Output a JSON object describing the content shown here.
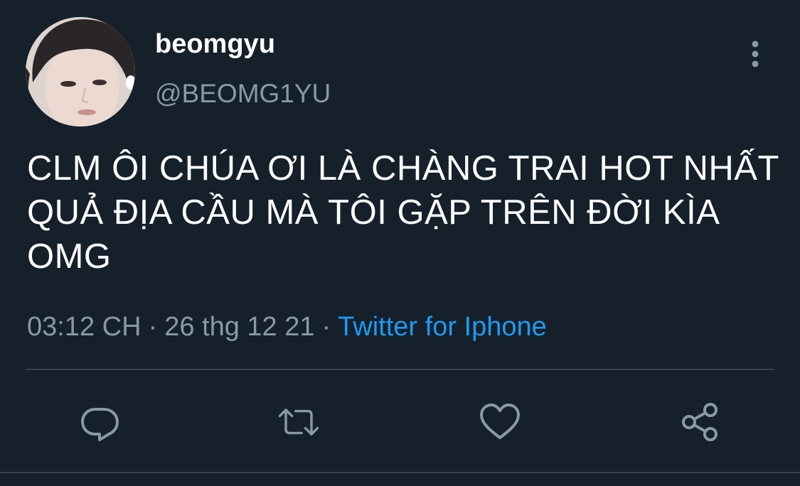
{
  "tweet": {
    "display_name": "beomgyu",
    "handle": "@BEOMG1YU",
    "text": "CLM ÔI CHÚA ƠI LÀ CHÀNG TRAI HOT NHẤT QUẢ ĐỊA CẦU MÀ TÔI GẶP TRÊN ĐỜI KÌA OMG",
    "time": "03:12 CH",
    "date": "26 thg 12 21",
    "source": "Twitter for Iphone",
    "sep1": "·",
    "sep2": "·"
  },
  "colors": {
    "background": "#15202b",
    "secondary_text": "#8899a6",
    "link": "#1d9bf0",
    "divider": "#38444d"
  },
  "icons": {
    "more": "more-vertical-icon",
    "reply": "reply-icon",
    "retweet": "retweet-icon",
    "like": "heart-icon",
    "share": "share-icon"
  }
}
